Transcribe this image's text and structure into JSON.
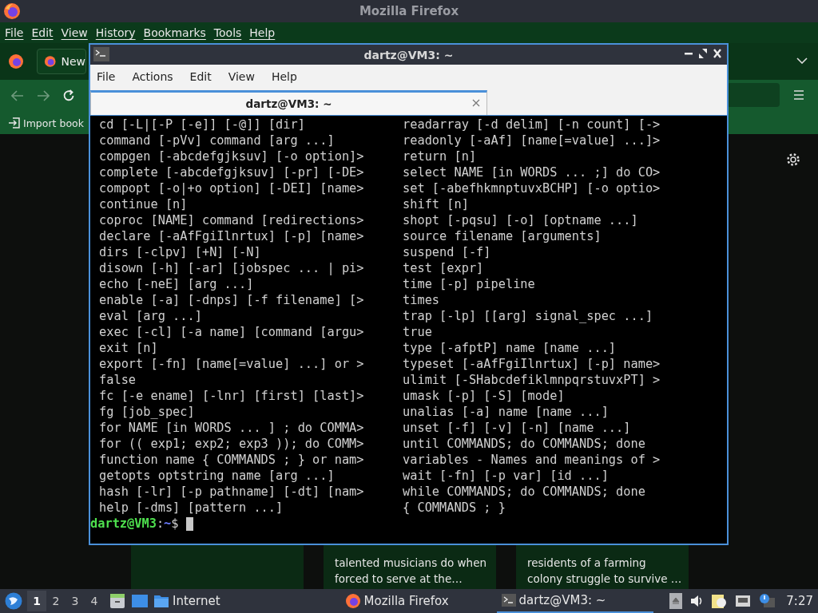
{
  "firefox": {
    "title": "Mozilla Firefox",
    "menu": [
      "File",
      "Edit",
      "View",
      "History",
      "Bookmarks",
      "Tools",
      "Help"
    ],
    "tab": {
      "label": "New"
    },
    "bookmark": "Import book",
    "cards": [
      {
        "lines": [
          "talented musicians do when",
          "forced to serve at the…"
        ]
      },
      {
        "lines": [
          "residents of a farming",
          "colony struggle to survive …"
        ]
      }
    ]
  },
  "terminal": {
    "title": "dartz@VM3: ~",
    "menu": [
      "File",
      "Actions",
      "Edit",
      "View",
      "Help"
    ],
    "tab": {
      "label": "dartz@VM3: ~",
      "selected": true
    },
    "lines": [
      [
        "cd [-L|[-P [-e]] [-@]] [dir]",
        "readarray [-d delim] [-n count] [->"
      ],
      [
        "command [-pVv] command [arg ...]",
        "readonly [-aAf] [name[=value] ...]>"
      ],
      [
        "compgen [-abcdefgjksuv] [-o option]>",
        "return [n]"
      ],
      [
        "complete [-abcdefgjksuv] [-pr] [-DE>",
        "select NAME [in WORDS ... ;] do CO>"
      ],
      [
        "compopt [-o|+o option] [-DEI] [name>",
        "set [-abefhkmnptuvxBCHP] [-o optio>"
      ],
      [
        "continue [n]",
        "shift [n]"
      ],
      [
        "coproc [NAME] command [redirections>",
        "shopt [-pqsu] [-o] [optname ...]"
      ],
      [
        "declare [-aAfFgiIlnrtux] [-p] [name>",
        "source filename [arguments]"
      ],
      [
        "dirs [-clpv] [+N] [-N]",
        "suspend [-f]"
      ],
      [
        "disown [-h] [-ar] [jobspec ... | pi>",
        "test [expr]"
      ],
      [
        "echo [-neE] [arg ...]",
        "time [-p] pipeline"
      ],
      [
        "enable [-a] [-dnps] [-f filename] [>",
        "times"
      ],
      [
        "eval [arg ...]",
        "trap [-lp] [[arg] signal_spec ...]"
      ],
      [
        "exec [-cl] [-a name] [command [argu>",
        "true"
      ],
      [
        "exit [n]",
        "type [-afptP] name [name ...]"
      ],
      [
        "export [-fn] [name[=value] ...] or >",
        "typeset [-aAfFgiIlnrtux] [-p] name>"
      ],
      [
        "false",
        "ulimit [-SHabcdefiklmnpqrstuvxPT] >"
      ],
      [
        "fc [-e ename] [-lnr] [first] [last]>",
        "umask [-p] [-S] [mode]"
      ],
      [
        "fg [job_spec]",
        "unalias [-a] name [name ...]"
      ],
      [
        "for NAME [in WORDS ... ] ; do COMMA>",
        "unset [-f] [-v] [-n] [name ...]"
      ],
      [
        "for (( exp1; exp2; exp3 )); do COMM>",
        "until COMMANDS; do COMMANDS; done"
      ],
      [
        "function name { COMMANDS ; } or nam>",
        "variables - Names and meanings of >"
      ],
      [
        "getopts optstring name [arg ...]",
        "wait [-fn] [-p var] [id ...]"
      ],
      [
        "hash [-lr] [-p pathname] [-dt] [nam>",
        "while COMMANDS; do COMMANDS; done"
      ],
      [
        "help [-dms] [pattern ...]",
        "{ COMMANDS ; }"
      ]
    ],
    "prompt": {
      "user_host": "dartz@VM3",
      "separator": ":",
      "path": "~",
      "symbol": "$"
    }
  },
  "taskbar": {
    "workspaces": [
      {
        "label": "1",
        "selected": true
      },
      {
        "label": "2",
        "selected": false
      },
      {
        "label": "3",
        "selected": false
      },
      {
        "label": "4",
        "selected": false
      }
    ],
    "launcher": "Internet",
    "tasks": [
      {
        "kind": "firefox",
        "label": "Mozilla Firefox",
        "selected": false
      },
      {
        "kind": "terminal",
        "label": "dartz@VM3: ~",
        "selected": true
      }
    ],
    "clock": "7:27"
  }
}
